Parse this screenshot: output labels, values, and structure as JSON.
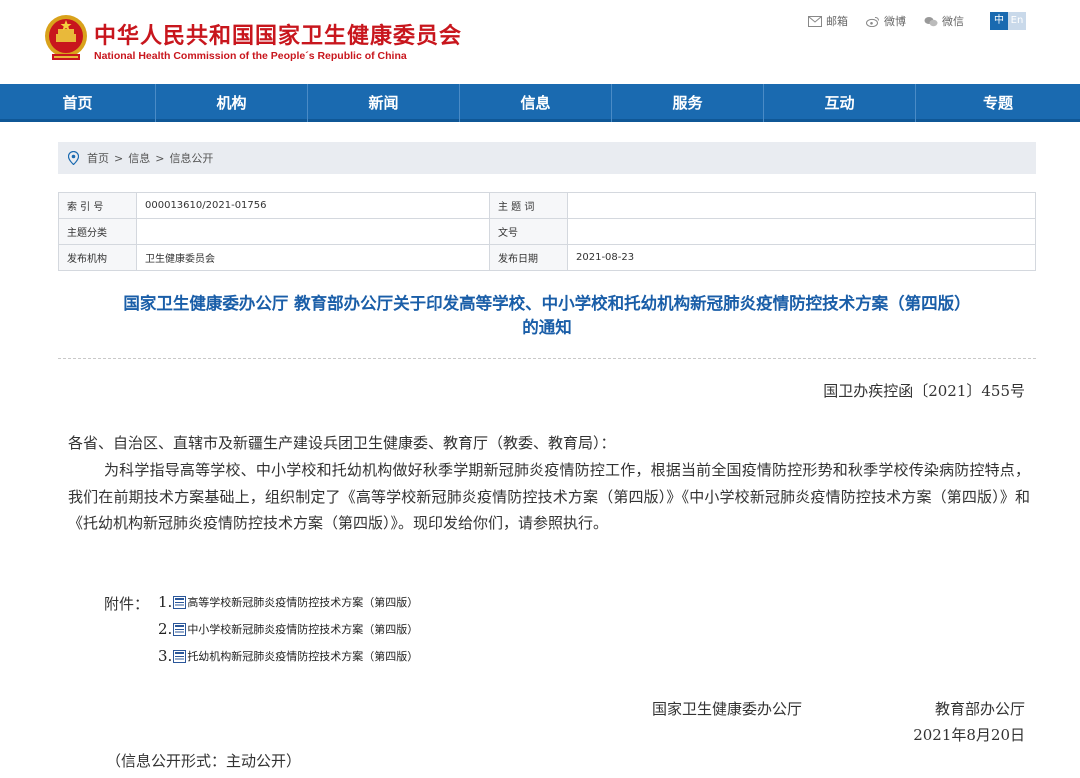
{
  "header": {
    "org_name_cn": "中华人民共和国国家卫生健康委员会",
    "org_name_en": "National Health Commission of the People´s Republic of China",
    "links": [
      {
        "icon": "mail-icon",
        "label": "邮箱"
      },
      {
        "icon": "weibo-icon",
        "label": "微博"
      },
      {
        "icon": "wechat-icon",
        "label": "微信"
      }
    ],
    "lang": {
      "zh": "中",
      "en": "En"
    }
  },
  "nav": [
    {
      "label": "首页"
    },
    {
      "label": "机构"
    },
    {
      "label": "新闻"
    },
    {
      "label": "信息"
    },
    {
      "label": "服务"
    },
    {
      "label": "互动"
    },
    {
      "label": "专题"
    }
  ],
  "breadcrumb": {
    "items": [
      "首页",
      "信息",
      "信息公开"
    ],
    "separator": ">"
  },
  "meta": {
    "index_label": "索 引 号",
    "index_value": "000013610/2021-01756",
    "subject_word_label": "主 题 词",
    "subject_word_value": "",
    "category_label": "主题分类",
    "category_value": "",
    "doc_num_label": "文号",
    "doc_num_value": "",
    "publisher_label": "发布机构",
    "publisher_value": "卫生健康委员会",
    "date_label": "发布日期",
    "date_value": "2021-08-23"
  },
  "document": {
    "title_line1": "国家卫生健康委办公厅 教育部办公厅关于印发高等学校、中小学校和托幼机构新冠肺炎疫情防控技术方案（第四版）",
    "title_line2": "的通知",
    "doc_number": "国卫办疾控函〔2021〕455号",
    "addressee": "各省、自治区、直辖市及新疆生产建设兵团卫生健康委、教育厅（教委、教育局）：",
    "body": "为科学指导高等学校、中小学校和托幼机构做好秋季学期新冠肺炎疫情防控工作，根据当前全国疫情防控形势和秋季学校传染病防控特点，我们在前期技术方案基础上，组织制定了《高等学校新冠肺炎疫情防控技术方案（第四版）》《中小学校新冠肺炎疫情防控技术方案（第四版）》和《托幼机构新冠肺炎疫情防控技术方案（第四版）》。现印发给你们，请参照执行。",
    "attachments_label": "附件：",
    "attachments": [
      {
        "num": "1.",
        "title": "高等学校新冠肺炎疫情防控技术方案（第四版）"
      },
      {
        "num": "2.",
        "title": "中小学校新冠肺炎疫情防控技术方案（第四版）"
      },
      {
        "num": "3.",
        "title": "托幼机构新冠肺炎疫情防控技术方案（第四版）"
      }
    ],
    "signer1": "国家卫生健康委办公厅",
    "signer2": "教育部办公厅",
    "date": "2021年8月20日",
    "disclosure": "（信息公开形式：主动公开）"
  },
  "colors": {
    "brand_red": "#c8161d",
    "nav_blue": "#1a6ab0",
    "title_blue": "#1a5ea8"
  }
}
